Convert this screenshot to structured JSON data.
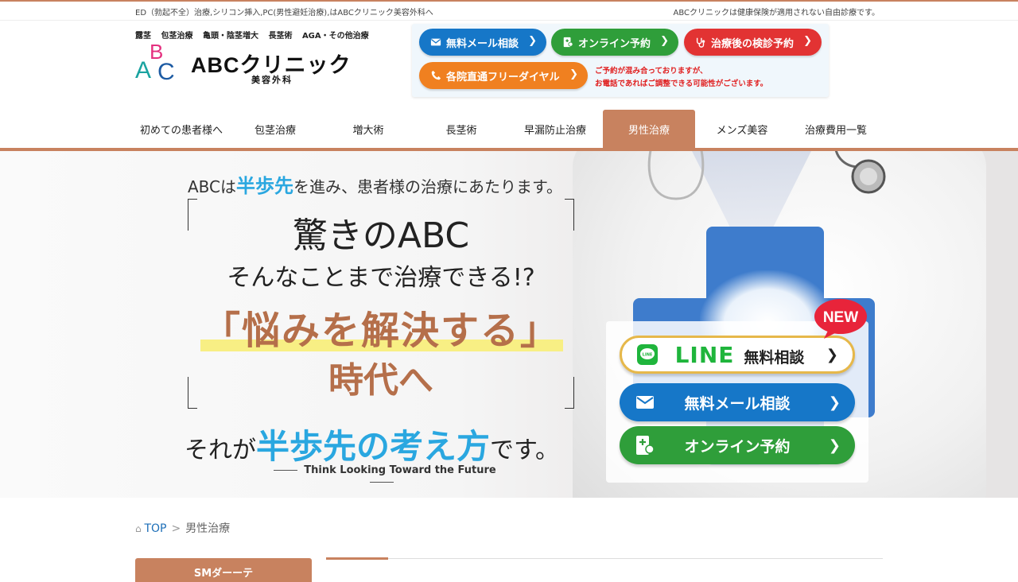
{
  "topbar": {
    "left_text": "ED（勃起不全）治療,シリコン挿入,PC(男性避妊治療),はABCクリニック美容外科へ",
    "right_text": "ABCクリニックは健康保険が適用されない自由診療です。"
  },
  "header": {
    "categories": [
      "露茎",
      "包茎治療",
      "亀頭・陰茎増大",
      "長茎術",
      "AGA・その他治療"
    ],
    "logo_letters": {
      "a": "A",
      "b": "B",
      "c": "C"
    },
    "logo_name": "ABCクリニック",
    "logo_sub": "美容外科",
    "cta": {
      "mail": "無料メール相談",
      "online": "オンライン予約",
      "recheck": "治療後の検診予約",
      "tel": "各院直通フリーダイヤル",
      "note_line1": "ご予約が混み合っておりますが、",
      "note_line2": "お電話であればご調整できる可能性がございます。"
    }
  },
  "nav": {
    "items": [
      "初めての患者様へ",
      "包茎治療",
      "増大術",
      "長茎術",
      "早漏防止治療",
      "男性治療",
      "メンズ美容",
      "治療費用一覧"
    ],
    "active_index": 5
  },
  "hero": {
    "lead_pre": "ABCは",
    "lead_hl": "半歩先",
    "lead_post": "を進み、患者様の治療にあたります。",
    "line1": "驚きのABC",
    "line2": "そんなことまで治療できる!?",
    "line3": "「悩みを解決する」",
    "line4": "時代へ",
    "foot_pre": "それが",
    "foot_hl": "半歩先の考え方",
    "foot_post": "です。",
    "english": "Think Looking Toward the Future",
    "new_badge": "NEW",
    "line_icon_text": "LINE",
    "buttons": {
      "line_logo": "LINE",
      "line_label": "無料相談",
      "mail_label": "無料メール相談",
      "online_label": "オンライン予約"
    }
  },
  "breadcrumb": {
    "home": "TOP",
    "separator": ">",
    "current": "男性治療"
  },
  "sidebar": {
    "tab_label": "SMダーーテ"
  },
  "colors": {
    "accent": "#c8825f",
    "blue": "#1677c8",
    "green": "#2f9e3a",
    "red": "#e23333",
    "orange": "#f08020",
    "highlight_blue": "#2aa7e0"
  }
}
